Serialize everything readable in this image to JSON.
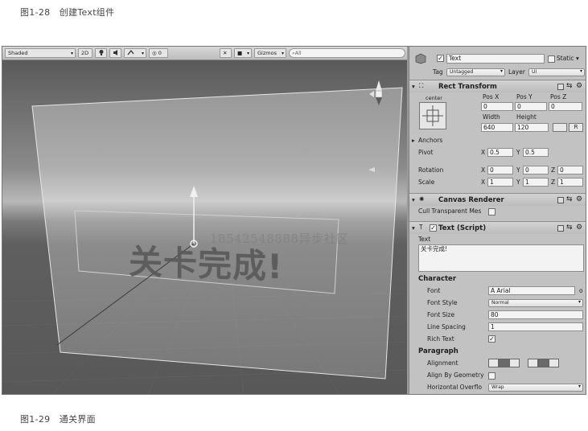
{
  "captions": {
    "top": "图1-28　创建Text组件",
    "bottom": "图1-29　通关界面"
  },
  "scene": {
    "toolbar": {
      "shading": "Shaded",
      "mode_2d": "2D",
      "fx_count": "0",
      "gizmos": "Gizmos",
      "search_placeholder": "All"
    },
    "big_text": "关卡完成!",
    "watermark": "18542548888异步社区"
  },
  "inspector": {
    "object_name": "Text",
    "static_label": "Static",
    "tag_label": "Tag",
    "tag_value": "Untagged",
    "layer_label": "Layer",
    "layer_value": "UI",
    "rect_transform": {
      "title": "Rect Transform",
      "anchor_h": "center",
      "anchor_v": "middle",
      "pos_x_label": "Pos X",
      "pos_y_label": "Pos Y",
      "pos_z_label": "Pos Z",
      "pos_x": "0",
      "pos_y": "0",
      "pos_z": "0",
      "width_label": "Width",
      "height_label": "Height",
      "width": "640",
      "height": "120",
      "r_button": "R",
      "anchors_label": "Anchors",
      "pivot_label": "Pivot",
      "pivot_x": "0.5",
      "pivot_y": "0.5",
      "rotation_label": "Rotation",
      "rot_x": "0",
      "rot_y": "0",
      "rot_z": "0",
      "scale_label": "Scale",
      "scale_x": "1",
      "scale_y": "1",
      "scale_z": "1",
      "x": "X",
      "y": "Y",
      "z": "Z"
    },
    "canvas_renderer": {
      "title": "Canvas Renderer",
      "cull_label": "Cull Transparent Mes"
    },
    "text_script": {
      "title": "Text (Script)",
      "text_label": "Text",
      "text_value": "关卡完成!",
      "character_label": "Character",
      "font_label": "Font",
      "font_value": "Arial",
      "font_trailing": "o",
      "font_style_label": "Font Style",
      "font_style_value": "Normal",
      "font_size_label": "Font Size",
      "font_size_value": "80",
      "line_spacing_label": "Line Spacing",
      "line_spacing_value": "1",
      "rich_text_label": "Rich Text",
      "paragraph_label": "Paragraph",
      "alignment_label": "Alignment",
      "align_geometry_label": "Align By Geometry",
      "h_overflow_label": "Horizontal Overflo",
      "h_overflow_value": "Wrap"
    }
  },
  "colors": {
    "inspector_bg": "#c2c2c2",
    "scene_bg": "#5e5e5e",
    "toolbar_bg": "#cfcfcf"
  }
}
